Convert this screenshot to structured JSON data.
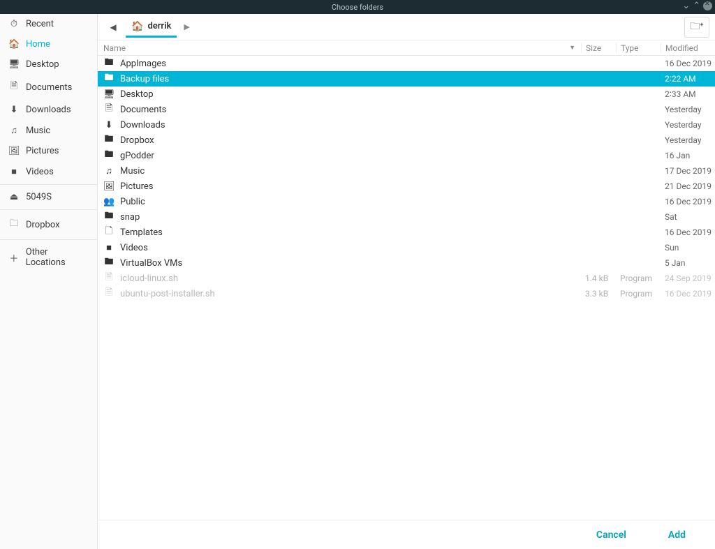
{
  "window": {
    "title": "Choose folders"
  },
  "sidebar": {
    "groups": [
      [
        {
          "icon": "⏱",
          "label": "Recent",
          "name": "sidebar-item-recent"
        },
        {
          "icon": "🏠",
          "label": "Home",
          "name": "sidebar-item-home",
          "active": true
        },
        {
          "icon": "🖥",
          "label": "Desktop",
          "name": "sidebar-item-desktop"
        },
        {
          "icon": "🗎",
          "label": "Documents",
          "name": "sidebar-item-documents"
        },
        {
          "icon": "⬇",
          "label": "Downloads",
          "name": "sidebar-item-downloads"
        },
        {
          "icon": "♫",
          "label": "Music",
          "name": "sidebar-item-music"
        },
        {
          "icon": "🖼",
          "label": "Pictures",
          "name": "sidebar-item-pictures"
        },
        {
          "icon": "■",
          "label": "Videos",
          "name": "sidebar-item-videos"
        }
      ],
      [
        {
          "icon": "⏏",
          "label": "5049S",
          "name": "sidebar-item-drive"
        }
      ],
      [
        {
          "icon": "🗀",
          "label": "Dropbox",
          "name": "sidebar-item-dropbox"
        }
      ],
      [
        {
          "icon": "＋",
          "label": "Other Locations",
          "name": "sidebar-item-other-locations"
        }
      ]
    ]
  },
  "breadcrumb": {
    "home_icon": "🏠",
    "current": "derrik"
  },
  "columns": {
    "name": "Name",
    "size": "Size",
    "type": "Type",
    "modified": "Modified"
  },
  "files": [
    {
      "icon": "folder",
      "name": "AppImages",
      "size": "",
      "type": "",
      "modified": "16 Dec 2019"
    },
    {
      "icon": "folder",
      "name": "Backup files",
      "size": "",
      "type": "",
      "modified": "2∶22 AM",
      "selected": true
    },
    {
      "icon": "desktop",
      "name": "Desktop",
      "size": "",
      "type": "",
      "modified": "2∶33 AM"
    },
    {
      "icon": "doc",
      "name": "Documents",
      "size": "",
      "type": "",
      "modified": "Yesterday"
    },
    {
      "icon": "download",
      "name": "Downloads",
      "size": "",
      "type": "",
      "modified": "Yesterday"
    },
    {
      "icon": "folder",
      "name": "Dropbox",
      "size": "",
      "type": "",
      "modified": "Yesterday"
    },
    {
      "icon": "folder",
      "name": "gPodder",
      "size": "",
      "type": "",
      "modified": "16 Jan"
    },
    {
      "icon": "music",
      "name": "Music",
      "size": "",
      "type": "",
      "modified": "17 Dec 2019"
    },
    {
      "icon": "picture",
      "name": "Pictures",
      "size": "",
      "type": "",
      "modified": "21 Dec 2019"
    },
    {
      "icon": "public",
      "name": "Public",
      "size": "",
      "type": "",
      "modified": "16 Dec 2019"
    },
    {
      "icon": "folder",
      "name": "snap",
      "size": "",
      "type": "",
      "modified": "Sat"
    },
    {
      "icon": "template",
      "name": "Templates",
      "size": "",
      "type": "",
      "modified": "16 Dec 2019"
    },
    {
      "icon": "video",
      "name": "Videos",
      "size": "",
      "type": "",
      "modified": "Sun"
    },
    {
      "icon": "folder",
      "name": "VirtualBox VMs",
      "size": "",
      "type": "",
      "modified": "5 Jan"
    },
    {
      "icon": "script",
      "name": "icloud-linux.sh",
      "size": "1.4 kB",
      "type": "Program",
      "modified": "24 Sep 2019",
      "dim": true
    },
    {
      "icon": "script",
      "name": "ubuntu-post-installer.sh",
      "size": "3.3 kB",
      "type": "Program",
      "modified": "16 Dec 2019",
      "dim": true
    }
  ],
  "footer": {
    "cancel": "Cancel",
    "add": "Add"
  },
  "icons": {
    "folder": "🖿",
    "desktop": "🖥",
    "doc": "🗎",
    "download": "⬇",
    "music": "♫",
    "picture": "🖼",
    "public": "👥",
    "template": "🗋",
    "video": "■",
    "script": "🗎"
  }
}
